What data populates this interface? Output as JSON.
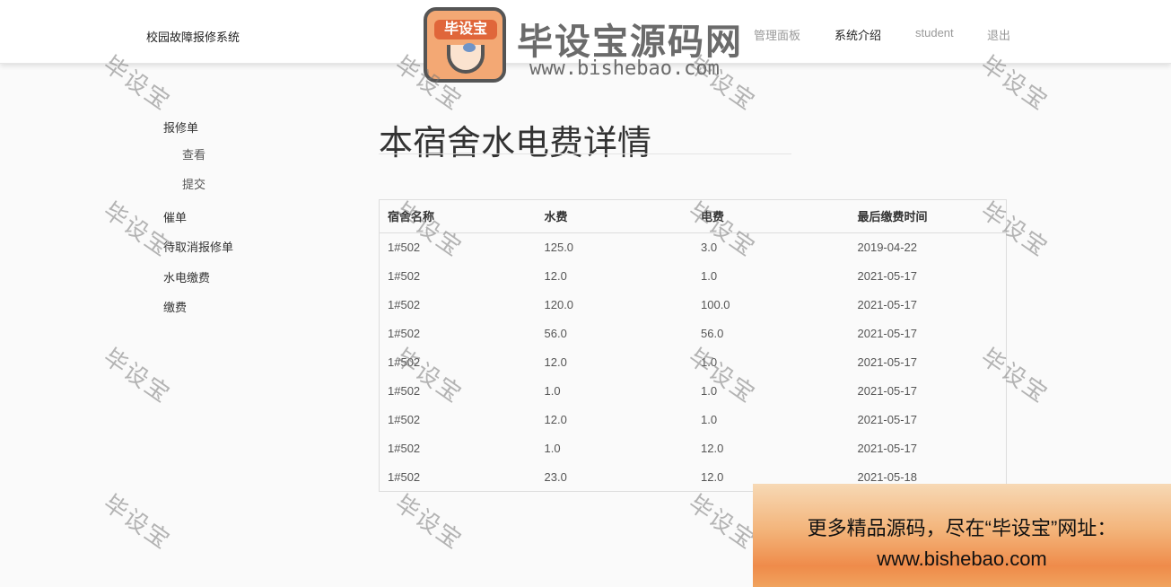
{
  "brand": {
    "title": "校园故障报修系统"
  },
  "nav": {
    "items": [
      {
        "label": "管理面板",
        "active": false
      },
      {
        "label": "系统介绍",
        "active": true
      },
      {
        "label": "student",
        "active": false
      },
      {
        "label": "退出",
        "active": false
      }
    ]
  },
  "logo": {
    "badge_text": "毕设宝",
    "title": "毕设宝源码网",
    "url": "www.bishebao.com"
  },
  "sidebar": {
    "items": [
      {
        "label": "报修单"
      },
      {
        "label": "查看"
      },
      {
        "label": "提交"
      },
      {
        "label": "催单"
      },
      {
        "label": "待取消报修单"
      },
      {
        "label": "水电缴费"
      },
      {
        "label": "缴费"
      }
    ]
  },
  "main": {
    "title": "本宿舍水电费详情",
    "table": {
      "headers": [
        "宿舍名称",
        "水费",
        "电费",
        "最后缴费时间"
      ],
      "rows": [
        [
          "1#502",
          "125.0",
          "3.0",
          "2019-04-22"
        ],
        [
          "1#502",
          "12.0",
          "1.0",
          "2021-05-17"
        ],
        [
          "1#502",
          "120.0",
          "100.0",
          "2021-05-17"
        ],
        [
          "1#502",
          "56.0",
          "56.0",
          "2021-05-17"
        ],
        [
          "1#502",
          "12.0",
          "1.0",
          "2021-05-17"
        ],
        [
          "1#502",
          "1.0",
          "1.0",
          "2021-05-17"
        ],
        [
          "1#502",
          "12.0",
          "1.0",
          "2021-05-17"
        ],
        [
          "1#502",
          "1.0",
          "12.0",
          "2021-05-17"
        ],
        [
          "1#502",
          "23.0",
          "12.0",
          "2021-05-18"
        ]
      ]
    }
  },
  "watermark": {
    "text": "毕设宝"
  },
  "banner": {
    "line1": "更多精品源码，尽在“毕设宝”网址：",
    "line2": "www.bishebao.com"
  }
}
